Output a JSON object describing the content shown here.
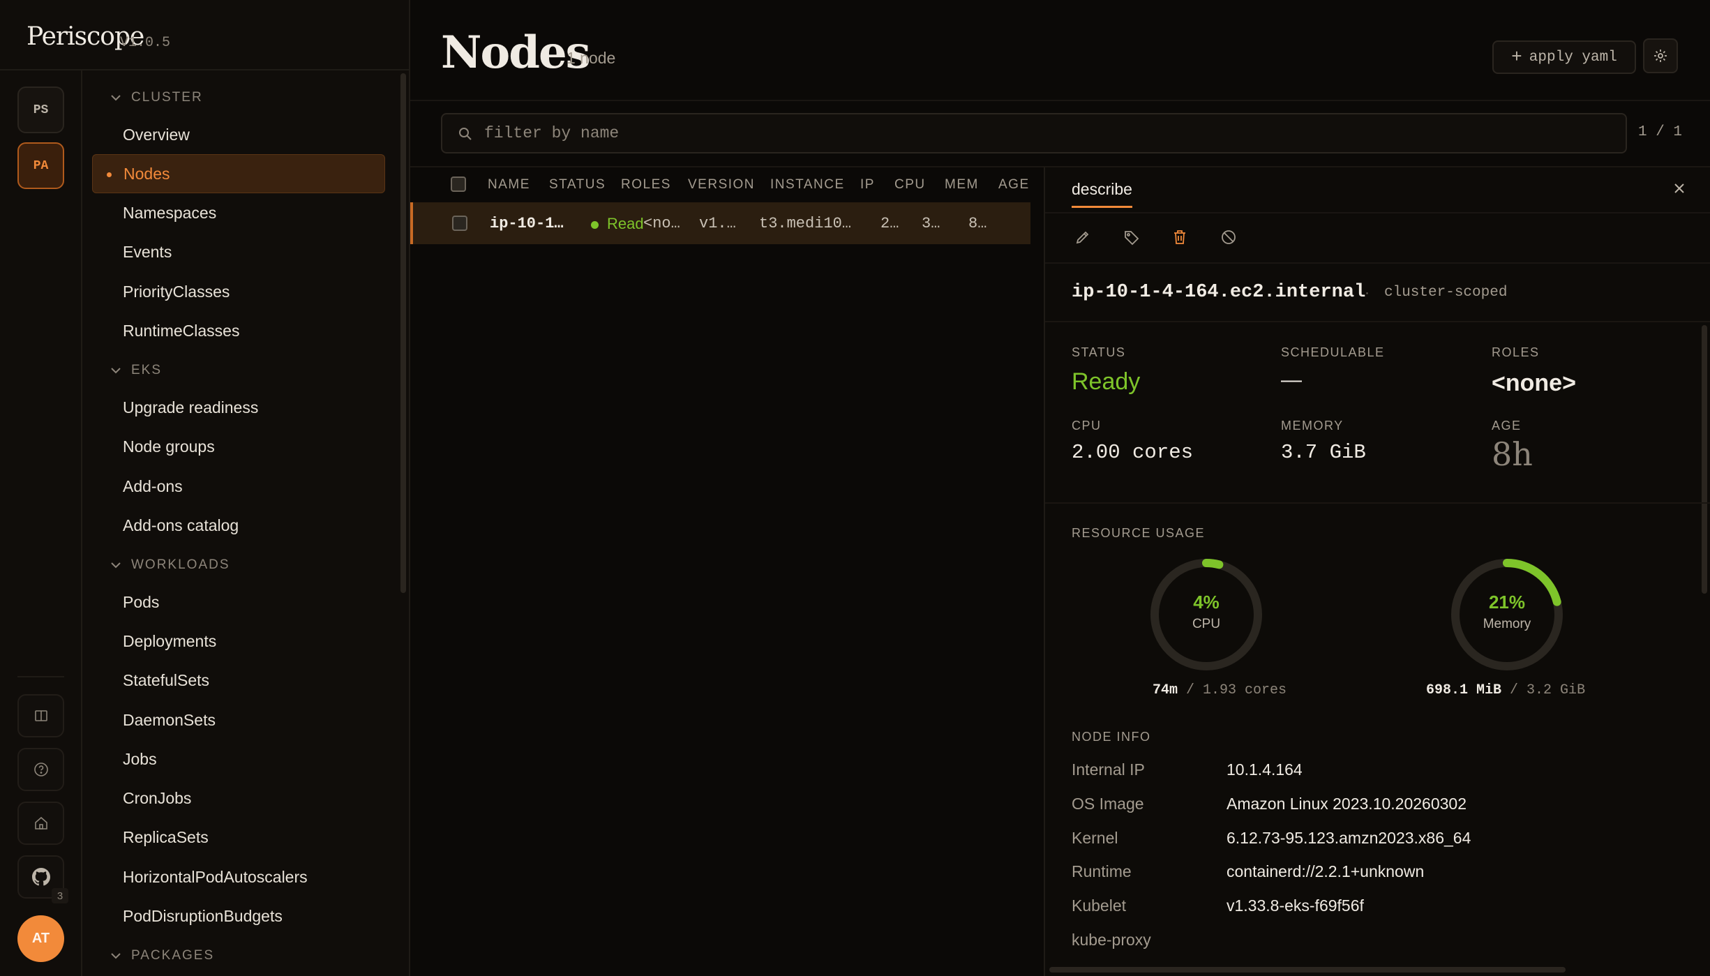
{
  "brand": {
    "name": "Periscope",
    "version": "V1.0.5"
  },
  "rail": {
    "contexts": [
      {
        "label": "PS"
      },
      {
        "label": "PA"
      }
    ],
    "badge": "3",
    "avatar": "AT"
  },
  "nav": {
    "sections": {
      "cluster": "CLUSTER",
      "eks": "EKS",
      "workloads": "WORKLOADS",
      "packages": "PACKAGES"
    },
    "cluster_items": [
      "Overview",
      "Nodes",
      "Namespaces",
      "Events",
      "PriorityClasses",
      "RuntimeClasses"
    ],
    "eks_items": [
      "Upgrade readiness",
      "Node groups",
      "Add-ons",
      "Add-ons catalog"
    ],
    "workload_items": [
      "Pods",
      "Deployments",
      "StatefulSets",
      "DaemonSets",
      "Jobs",
      "CronJobs",
      "ReplicaSets",
      "HorizontalPodAutoscalers",
      "PodDisruptionBudgets"
    ]
  },
  "header": {
    "title": "Nodes",
    "count": "1 node",
    "apply_label": "apply yaml"
  },
  "filter": {
    "placeholder": "filter by name",
    "pager": "1 / 1"
  },
  "table": {
    "columns": [
      "NAME",
      "STATUS",
      "ROLES",
      "VERSION",
      "INSTANCE",
      "IP",
      "CPU",
      "MEM",
      "AGE"
    ],
    "rows": [
      {
        "name": "ip-10-1…",
        "status": "Read",
        "roles": "<no…",
        "version": "v1.…",
        "instance": "t3.medi10…",
        "ip": "2…",
        "cpu": "3…",
        "mem": "8…"
      }
    ]
  },
  "panel": {
    "tab": "describe",
    "resource_name": "ip-10-1-4-164.ec2.internal",
    "separator": "·",
    "scope": "cluster-scoped",
    "summary": {
      "status_label": "STATUS",
      "status": "Ready",
      "schedulable_label": "SCHEDULABLE",
      "schedulable": "—",
      "roles_label": "ROLES",
      "roles": "<none>",
      "cpu_label": "CPU",
      "cpu": "2.00 cores",
      "memory_label": "MEMORY",
      "memory": "3.7 GiB",
      "age_label": "AGE",
      "age": "8h"
    },
    "usage": {
      "title": "RESOURCE USAGE",
      "cpu": {
        "pct": "4%",
        "fraction": 0.04,
        "label": "CPU",
        "used": "74m",
        "total": "/ 1.93 cores"
      },
      "memory": {
        "pct": "21%",
        "fraction": 0.21,
        "label": "Memory",
        "used": "698.1 MiB",
        "total": "/ 3.2 GiB"
      }
    },
    "node_info": {
      "title": "NODE INFO",
      "rows": [
        {
          "label": "Internal IP",
          "value": "10.1.4.164"
        },
        {
          "label": "OS Image",
          "value": "Amazon Linux 2023.10.20260302"
        },
        {
          "label": "Kernel",
          "value": "6.12.73-95.123.amzn2023.x86_64"
        },
        {
          "label": "Runtime",
          "value": "containerd://2.2.1+unknown"
        },
        {
          "label": "Kubelet",
          "value": "v1.33.8-eks-f69f56f"
        },
        {
          "label": "kube-proxy",
          "value": ""
        }
      ]
    }
  },
  "colors": {
    "accent": "#f28a3a",
    "ready": "#7ec42a",
    "background": "#0b0907"
  }
}
